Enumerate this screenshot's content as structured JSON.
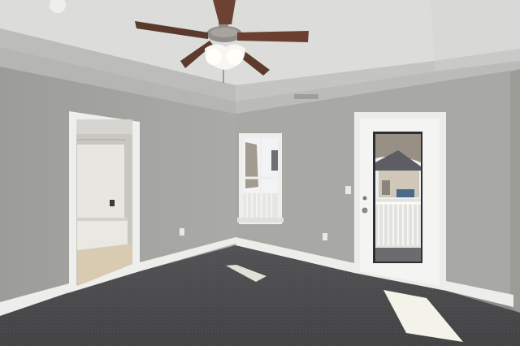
{
  "scene": {
    "subject": "empty-bedroom-interior",
    "colors": {
      "wall": "#a7a7a4",
      "wall_dark": "#9a9a97",
      "ceiling": "#c9c9c7",
      "ceiling_tray": "#d7d7d5",
      "trim": "#ececea",
      "carpet": "#4d4d4f",
      "sunlight": "#f3f1e4",
      "fan_blade": "#6b4030",
      "fan_metal": "#8d8a86",
      "sky": "#eef1f3",
      "tree": "#7f7467",
      "house_roof": "#5c5e63",
      "house_wall": "#c8c0b2"
    }
  }
}
